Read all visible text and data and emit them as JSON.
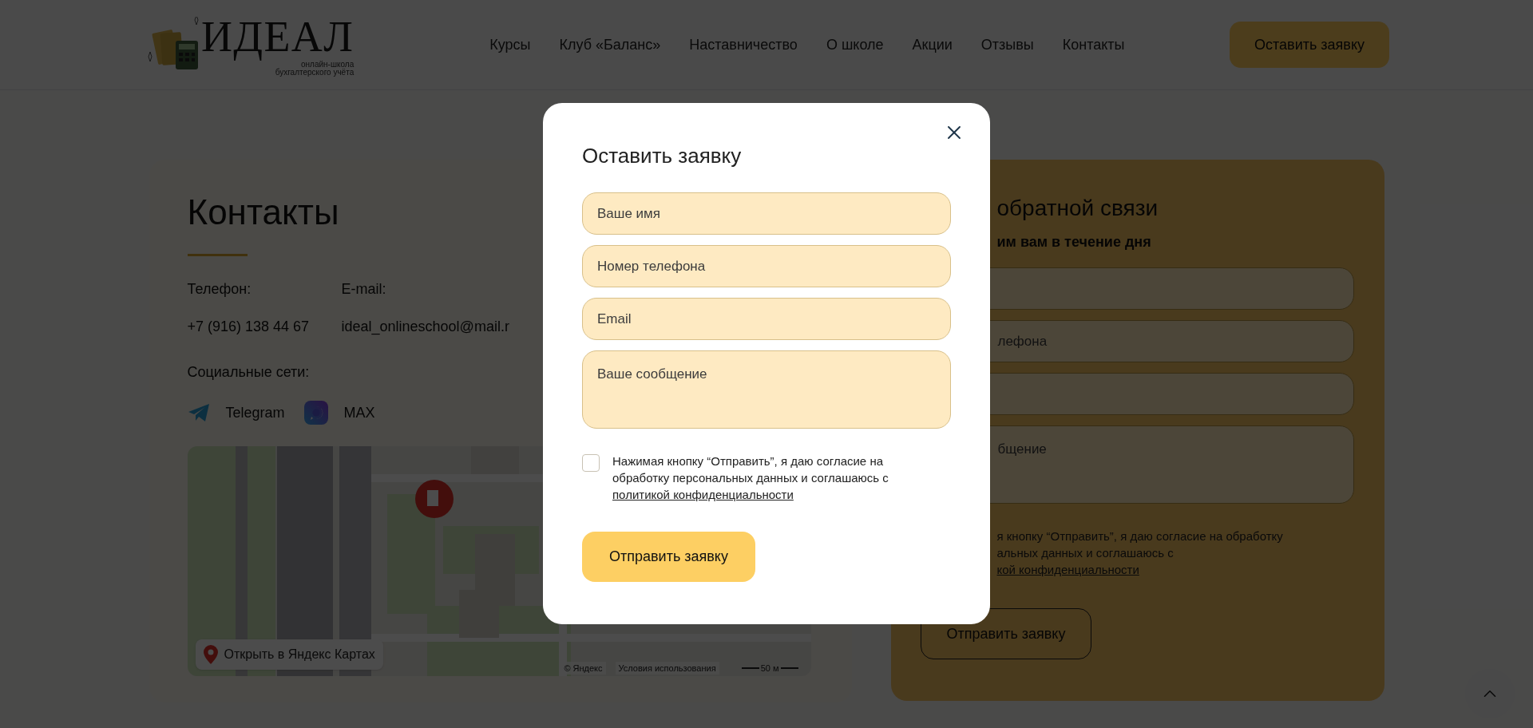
{
  "header": {
    "logo": {
      "title": "ИДЕАЛ",
      "subtitle_lines": [
        "онлайн-школа",
        "бухгалтерского учёта"
      ]
    },
    "nav": [
      "Курсы",
      "Клуб «Баланс»",
      "Наставничество",
      "О школе",
      "Акции",
      "Отзывы",
      "Контакты"
    ],
    "cta": "Оставить заявку"
  },
  "contacts": {
    "title": "Контакты",
    "phone_label": "Телефон:",
    "phone": "+7 (916) 138 44 67",
    "email_label": "E-mail:",
    "email": "ideal_onlineschool@mail.r",
    "social_label": "Социальные сети:",
    "social": [
      {
        "kind": "telegram",
        "label": "Telegram"
      },
      {
        "kind": "max",
        "label": "MAX"
      }
    ],
    "map": {
      "open_button": "Открыть в Яндекс Картах",
      "copyright": "© Яндекс",
      "terms": "Условия использования",
      "scale": "50 м"
    }
  },
  "feedback": {
    "title": "обратной связи",
    "subtitle": "им вам в течение дня",
    "fields": [
      {
        "kind": "input"
      },
      {
        "kind": "input",
        "placeholder": "лефона"
      },
      {
        "kind": "input"
      },
      {
        "kind": "textarea",
        "placeholder": "бщение"
      }
    ],
    "consent_lines": [
      "я кнопку “Отправить”, я даю согласие на обработку",
      "альных данных и соглашаюсь с"
    ],
    "policy_link": "кой конфиденциальности",
    "submit": "Отправить заявку"
  },
  "modal": {
    "title": "Оставить заявку",
    "fields": [
      {
        "kind": "input",
        "placeholder": "Ваше имя"
      },
      {
        "kind": "input",
        "placeholder": "Номер телефона"
      },
      {
        "kind": "input",
        "placeholder": "Email"
      },
      {
        "kind": "textarea",
        "placeholder": "Ваше сообщение"
      }
    ],
    "consent": {
      "checked": false,
      "text": "Нажимая кнопку “Отправить”, я даю согласие на обработку персональных данных и соглашаюсь с ",
      "link": "политикой конфиденциальности"
    },
    "submit": "Отправить заявку"
  }
}
